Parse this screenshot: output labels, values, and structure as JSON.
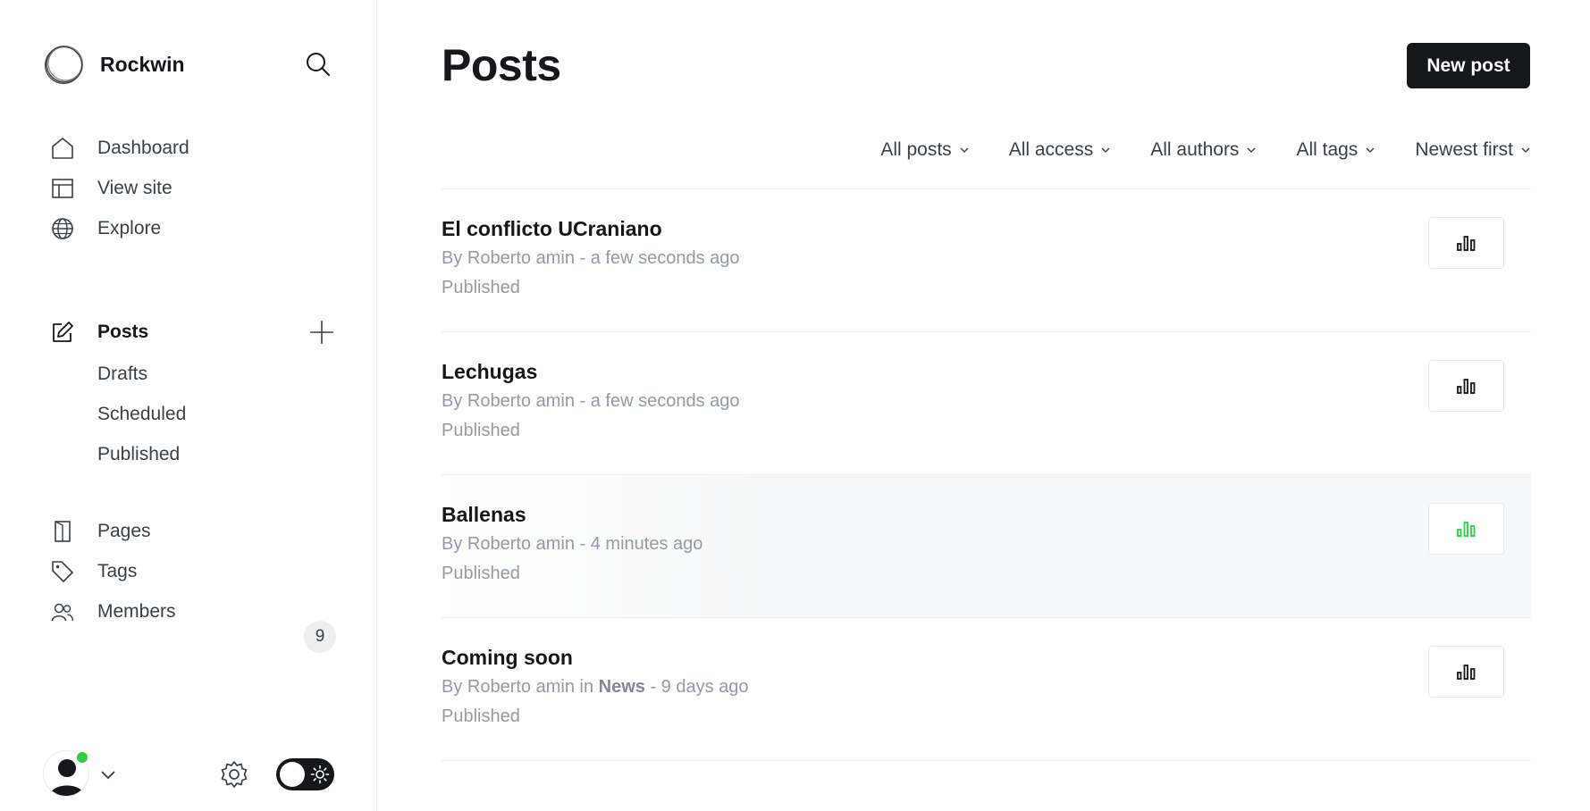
{
  "brand": {
    "name": "Rockwin"
  },
  "sidebar": {
    "nav": [
      {
        "label": "Dashboard",
        "icon": "house-icon"
      },
      {
        "label": "View site",
        "icon": "layout-icon"
      },
      {
        "label": "Explore",
        "icon": "globe-icon"
      }
    ],
    "posts": {
      "label": "Posts",
      "icon": "pencil-square-icon"
    },
    "post_subitems": [
      "Drafts",
      "Scheduled",
      "Published"
    ],
    "secondary": [
      {
        "label": "Pages",
        "icon": "page-icon"
      },
      {
        "label": "Tags",
        "icon": "tag-icon"
      },
      {
        "label": "Members",
        "icon": "users-icon",
        "badge": "9"
      }
    ],
    "user": {
      "status_color": "#30cf43"
    }
  },
  "main": {
    "title": "Posts",
    "new_post_label": "New post",
    "filters": [
      "All posts",
      "All access",
      "All authors",
      "All tags",
      "Newest first"
    ],
    "posts": [
      {
        "title": "El conflicto UCraniano",
        "meta_before_tag": "By Roberto amin - a few seconds ago",
        "tag": "",
        "meta_after_tag": "",
        "status": "Published",
        "stats_color": "#15171a",
        "hover": false
      },
      {
        "title": "Lechugas",
        "meta_before_tag": "By Roberto amin - a few seconds ago",
        "tag": "",
        "meta_after_tag": "",
        "status": "Published",
        "stats_color": "#15171a",
        "hover": false
      },
      {
        "title": "Ballenas",
        "meta_before_tag": "By Roberto amin - 4 minutes ago",
        "tag": "",
        "meta_after_tag": "",
        "status": "Published",
        "stats_color": "#30cf43",
        "hover": true
      },
      {
        "title": "Coming soon",
        "meta_before_tag": "By Roberto amin in ",
        "tag": "News",
        "meta_after_tag": " - 9 days ago",
        "status": "Published",
        "stats_color": "#15171a",
        "hover": false
      }
    ]
  },
  "colors": {
    "accent": "#15171a",
    "online": "#30cf43",
    "muted": "#8e9cac"
  }
}
